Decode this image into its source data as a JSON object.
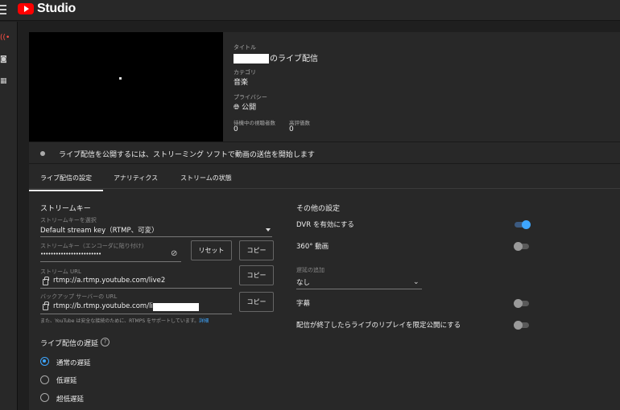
{
  "app": {
    "title": "Studio"
  },
  "meta": {
    "title_label": "タイトル",
    "title_suffix": "のライブ配信",
    "category_label": "カテゴリ",
    "category_value": "音楽",
    "privacy_label": "プライバシー",
    "privacy_value": "公開",
    "viewers_label": "待機中の視聴者数",
    "viewers_value": "0",
    "likes_label": "高評価数",
    "likes_value": "0"
  },
  "notice": "ライブ配信を公開するには、ストリーミング ソフトで動画の送信を開始します",
  "tabs": [
    "ライブ配信の設定",
    "アナリティクス",
    "ストリームの状態"
  ],
  "stream_key": {
    "section_title": "ストリームキー",
    "select_label": "ストリームキーを選択",
    "select_value": "Default stream key（RTMP、可変）",
    "key_label": "ストリームキー（エンコーダに貼り付け）",
    "key_value": "••••••••••••••••••••••••",
    "reset_label": "リセット",
    "copy_label": "コピー",
    "url_label": "ストリーム URL",
    "url_value": "rtmp://a.rtmp.youtube.com/live2",
    "backup_label": "バックアップ サーバーの URL",
    "backup_value": "rtmp://b.rtmp.youtube.com/liv",
    "note_text": "また、YouTube は安全な接続のために、RTMPS をサポートしています。",
    "note_link": "詳細"
  },
  "latency": {
    "title": "ライブ配信の遅延",
    "options": [
      "通常の遅延",
      "低遅延",
      "超低遅延"
    ],
    "selected": "通常の遅延"
  },
  "other": {
    "title": "その他の設定",
    "dvr_label": "DVR を有効にする",
    "dvr_on": true,
    "vr_label": "360° 動画",
    "vr_on": false,
    "delay_label": "遅延の追加",
    "delay_value": "なし",
    "captions_label": "字幕",
    "captions_on": false,
    "replay_label": "配信が終了したらライブのリプレイを限定公開にする",
    "replay_on": false
  }
}
